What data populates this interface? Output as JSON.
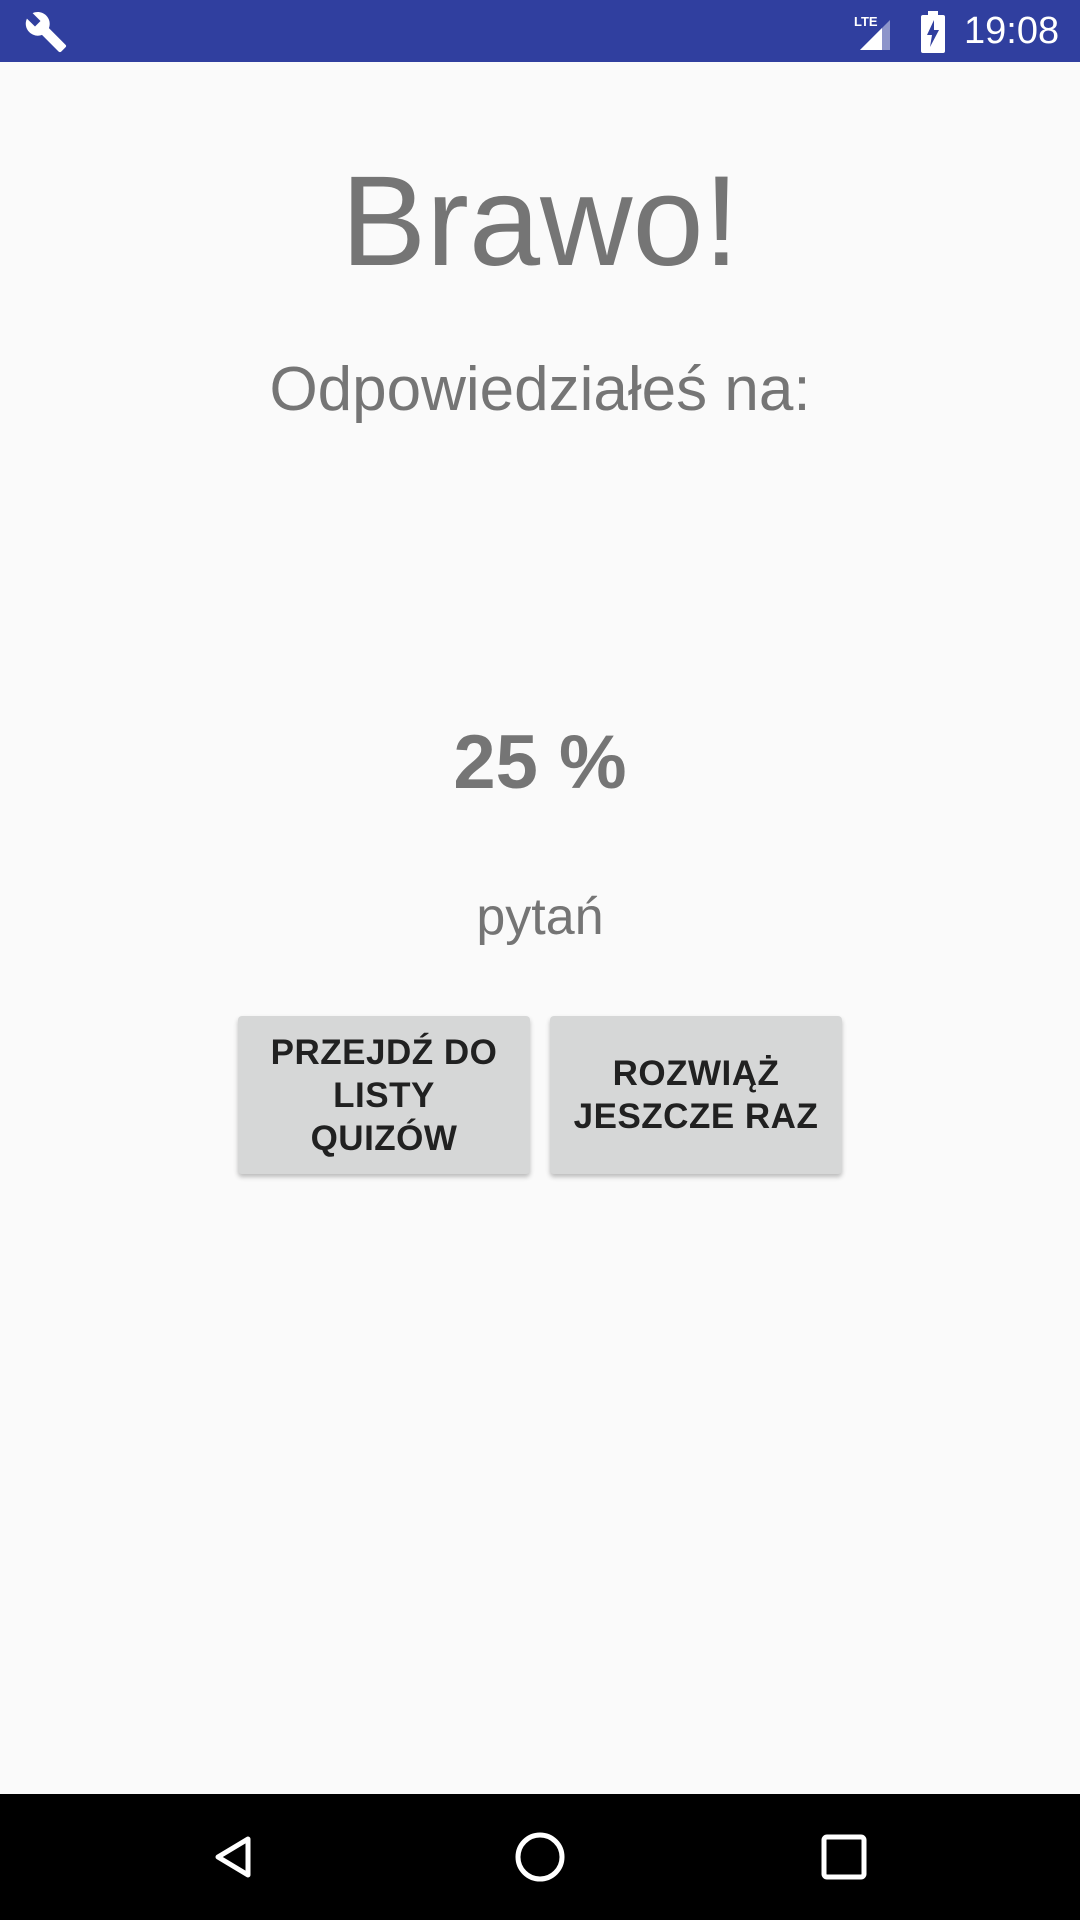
{
  "status_bar": {
    "time": "19:08",
    "network_label": "LTE",
    "left_icon": "wrench-icon",
    "background_color": "#303f9f"
  },
  "result": {
    "title": "Brawo!",
    "subtitle": "Odpowiedziałeś na:",
    "score": "25 %",
    "score_suffix": "pytań"
  },
  "actions": {
    "go_to_list_label": "PRZEJDŹ DO LISTY QUIZÓW",
    "retry_label": "ROZWIĄŻ JESZCZE RAZ"
  },
  "nav_bar": {
    "icons": [
      "back-icon",
      "home-icon",
      "recents-icon"
    ]
  },
  "colors": {
    "text_gray": "#757575",
    "button_bg": "#d6d7d7",
    "background": "#fafafa"
  }
}
